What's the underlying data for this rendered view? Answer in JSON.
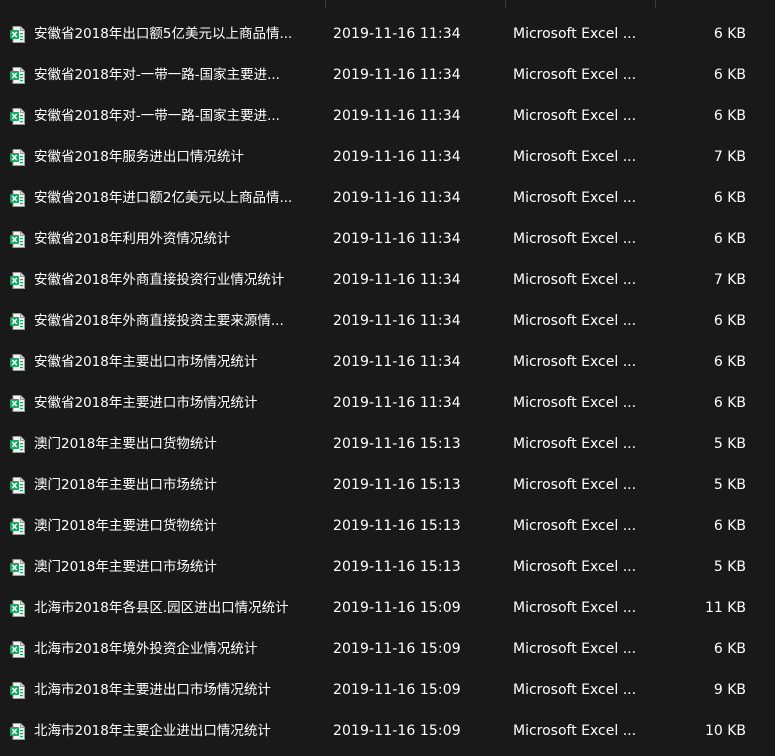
{
  "colors": {
    "background": "#191919",
    "text": "#ffffff",
    "excel_green": "#21a366"
  },
  "files": [
    {
      "name": "安徽省2018年出口额5亿美元以上商品情...",
      "date": "2019-11-16 11:34",
      "type": "Microsoft Excel ...",
      "size": "6 KB",
      "icon": "excel-file-icon"
    },
    {
      "name": "安徽省2018年对-一带一路-国家主要进...",
      "date": "2019-11-16 11:34",
      "type": "Microsoft Excel ...",
      "size": "6 KB",
      "icon": "excel-file-icon"
    },
    {
      "name": "安徽省2018年对-一带一路-国家主要进...",
      "date": "2019-11-16 11:34",
      "type": "Microsoft Excel ...",
      "size": "6 KB",
      "icon": "excel-file-icon"
    },
    {
      "name": "安徽省2018年服务进出口情况统计",
      "date": "2019-11-16 11:34",
      "type": "Microsoft Excel ...",
      "size": "7 KB",
      "icon": "excel-file-icon"
    },
    {
      "name": "安徽省2018年进口额2亿美元以上商品情...",
      "date": "2019-11-16 11:34",
      "type": "Microsoft Excel ...",
      "size": "6 KB",
      "icon": "excel-file-icon"
    },
    {
      "name": "安徽省2018年利用外资情况统计",
      "date": "2019-11-16 11:34",
      "type": "Microsoft Excel ...",
      "size": "6 KB",
      "icon": "excel-file-icon"
    },
    {
      "name": "安徽省2018年外商直接投资行业情况统计",
      "date": "2019-11-16 11:34",
      "type": "Microsoft Excel ...",
      "size": "7 KB",
      "icon": "excel-file-icon"
    },
    {
      "name": "安徽省2018年外商直接投资主要来源情...",
      "date": "2019-11-16 11:34",
      "type": "Microsoft Excel ...",
      "size": "6 KB",
      "icon": "excel-file-icon"
    },
    {
      "name": "安徽省2018年主要出口市场情况统计",
      "date": "2019-11-16 11:34",
      "type": "Microsoft Excel ...",
      "size": "6 KB",
      "icon": "excel-file-icon"
    },
    {
      "name": "安徽省2018年主要进口市场情况统计",
      "date": "2019-11-16 11:34",
      "type": "Microsoft Excel ...",
      "size": "6 KB",
      "icon": "excel-file-icon"
    },
    {
      "name": "澳门2018年主要出口货物统计",
      "date": "2019-11-16 15:13",
      "type": "Microsoft Excel ...",
      "size": "5 KB",
      "icon": "excel-file-icon"
    },
    {
      "name": "澳门2018年主要出口市场统计",
      "date": "2019-11-16 15:13",
      "type": "Microsoft Excel ...",
      "size": "5 KB",
      "icon": "excel-file-icon"
    },
    {
      "name": "澳门2018年主要进口货物统计",
      "date": "2019-11-16 15:13",
      "type": "Microsoft Excel ...",
      "size": "6 KB",
      "icon": "excel-file-icon"
    },
    {
      "name": "澳门2018年主要进口市场统计",
      "date": "2019-11-16 15:13",
      "type": "Microsoft Excel ...",
      "size": "5 KB",
      "icon": "excel-file-icon"
    },
    {
      "name": "北海市2018年各县区.园区进出口情况统计",
      "date": "2019-11-16 15:09",
      "type": "Microsoft Excel ...",
      "size": "11 KB",
      "icon": "excel-file-icon"
    },
    {
      "name": "北海市2018年境外投资企业情况统计",
      "date": "2019-11-16 15:09",
      "type": "Microsoft Excel ...",
      "size": "6 KB",
      "icon": "excel-file-icon"
    },
    {
      "name": "北海市2018年主要进出口市场情况统计",
      "date": "2019-11-16 15:09",
      "type": "Microsoft Excel ...",
      "size": "9 KB",
      "icon": "excel-file-icon"
    },
    {
      "name": "北海市2018年主要企业进出口情况统计",
      "date": "2019-11-16 15:09",
      "type": "Microsoft Excel ...",
      "size": "10 KB",
      "icon": "excel-file-icon"
    }
  ]
}
